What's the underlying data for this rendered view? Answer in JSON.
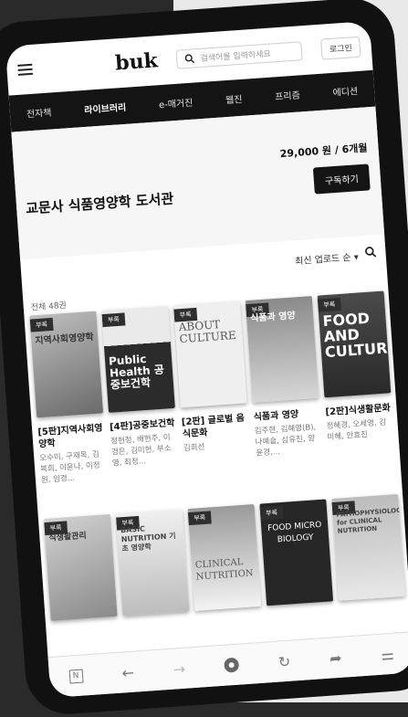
{
  "header": {
    "logo": "buk",
    "search_placeholder": "검색어를 입력하세요",
    "login_label": "로그인"
  },
  "nav": {
    "items": [
      "전자책",
      "라이브러리",
      "e-매거진",
      "웹진",
      "프리즘",
      "에디션"
    ],
    "active": "라이브러리"
  },
  "hero": {
    "title": "교문사 식품영양학 도서관",
    "price": "29,000 원 / 6개월",
    "subscribe_label": "구독하기"
  },
  "list": {
    "sort_label": "최신 업로드 순",
    "total_count": "전체 48권"
  },
  "books_row1": [
    {
      "badge": "부록",
      "cover_text": "지역사회영양학",
      "title": "[5판]지역사회영양학",
      "authors": "오수미, 구재옥, 김복희, 이윤나, 이정원, 임경..."
    },
    {
      "badge": "부록",
      "cover_text": "Public Health 공중보건학",
      "title": "[4판]공중보건학",
      "authors": "정현정, 배현주, 이경은, 김미현, 부소영, 최정..."
    },
    {
      "badge": "부록",
      "cover_text": "ABOUT CULTURE",
      "title": "[2판] 글로벌 음식문화",
      "authors": "김희선"
    },
    {
      "badge": "부록",
      "cover_text": "식품과 영양",
      "title": "식품과 영양",
      "authors": "김주현, 김혜영(B), 나예슬, 심유진, 양윤경,..."
    },
    {
      "badge": "부록",
      "cover_text": "FOOD AND CULTURE",
      "title": "[2판]식생활문화",
      "authors": "정혜경, 오세영, 김미혜, 안효진"
    }
  ],
  "books_row2": [
    {
      "badge": "부록",
      "cover_text": "식생활관리"
    },
    {
      "badge": "부록",
      "cover_text": "BASIC NUTRITION 기초 영양학"
    },
    {
      "badge": "부록",
      "cover_text": "CLINICAL NUTRITION"
    },
    {
      "badge": "부록",
      "cover_text": "FOOD MICRO BIOLOGY"
    },
    {
      "badge": "부록",
      "cover_text": "PATHOPHYSIOLOGY for CLINICAL NUTRITION"
    }
  ],
  "bottom_bar": {
    "items": [
      "n-icon",
      "back-icon",
      "forward-icon",
      "home-icon",
      "refresh-icon",
      "share-icon",
      "menu-icon"
    ]
  },
  "colors": {
    "nav_bg": "#141414",
    "hero_bg": "#f6f6f6",
    "badge_bg": "#2e2e2e"
  }
}
